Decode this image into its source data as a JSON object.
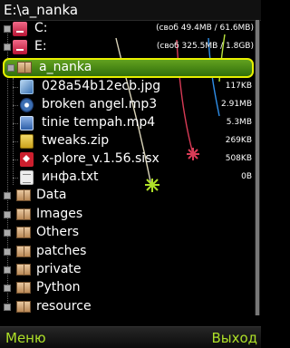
{
  "title_bar": {
    "path": "E:\\a_nanka"
  },
  "drives": [
    {
      "label": "C:",
      "free_space": "(своб 49.4MB / 61.6MB)",
      "icon": "drive-icon"
    },
    {
      "label": "E:",
      "free_space": "(своб 325.5MB / 1.8GB)",
      "icon": "drive-icon"
    }
  ],
  "selected_folder": {
    "label": "a_nanka",
    "icon": "folder-icon"
  },
  "files": [
    {
      "name": "028a54b12ecb.jpg",
      "size": "117KB",
      "icon": "image-file-icon"
    },
    {
      "name": "broken angel.mp3",
      "size": "2.91MB",
      "icon": "audio-file-icon"
    },
    {
      "name": "tinie tempah.mp4",
      "size": "5.3MB",
      "icon": "video-file-icon"
    },
    {
      "name": "tweaks.zip",
      "size": "269KB",
      "icon": "zip-file-icon"
    },
    {
      "name": "x-plore_v.1.56.sisx",
      "size": "508KB",
      "icon": "sis-file-icon"
    },
    {
      "name": "инфа.txt",
      "size": "0B",
      "icon": "text-file-icon"
    }
  ],
  "folders": [
    {
      "name": "Data",
      "icon": "folder-icon"
    },
    {
      "name": "Images",
      "icon": "folder-icon"
    },
    {
      "name": "Others",
      "icon": "folder-icon"
    },
    {
      "name": "patches",
      "icon": "folder-icon"
    },
    {
      "name": "private",
      "icon": "folder-icon"
    },
    {
      "name": "Python",
      "icon": "folder-icon"
    },
    {
      "name": "resource",
      "icon": "folder-icon"
    }
  ],
  "softkeys": {
    "left": "Меню",
    "right": "Выход"
  },
  "colors": {
    "background": "#000000",
    "selection_fill": "#3f8a17",
    "selection_border": "#e8f100",
    "softkey_text": "#aee028"
  }
}
